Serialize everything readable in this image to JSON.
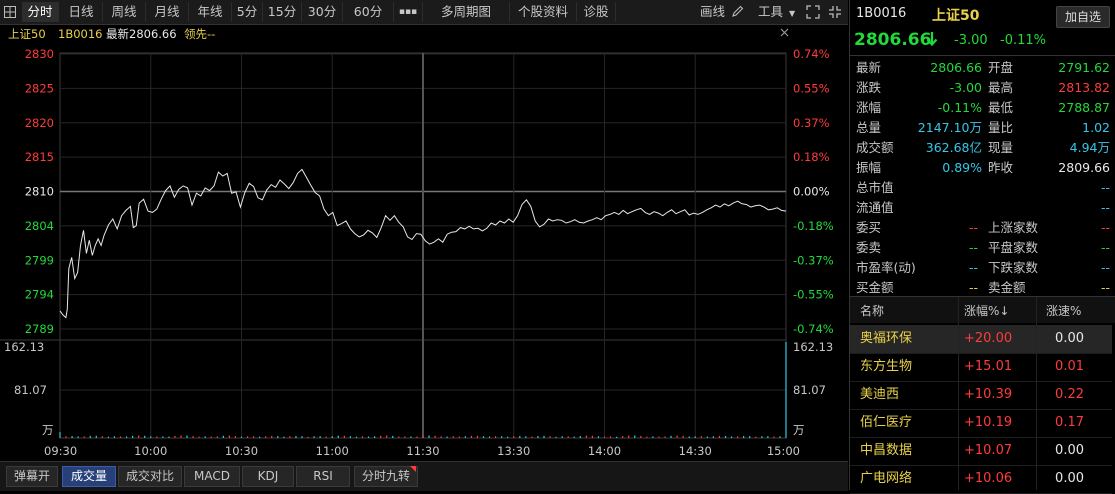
{
  "toolbar": {
    "tabs": [
      "分时",
      "日线",
      "周线",
      "月线",
      "年线",
      "5分",
      "15分",
      "30分",
      "60分",
      "▪▪▪",
      "多周期图",
      "个股资料",
      "诊股"
    ],
    "draw_label": "画线",
    "tools_label": "工具"
  },
  "chart_header": {
    "name": "上证50",
    "code": "1B0016",
    "latest": "最新2806.66",
    "lead": "领先--"
  },
  "chart_data": {
    "type": "line",
    "x_ticks": [
      "09:30",
      "10:00",
      "10:30",
      "11:00",
      "11:30",
      "13:30",
      "14:00",
      "14:30",
      "15:00"
    ],
    "y_left_ticks": [
      "2830",
      "2825",
      "2820",
      "2815",
      "2810",
      "2804",
      "2799",
      "2794",
      "2789"
    ],
    "y_right_ticks": [
      "0.74%",
      "0.55%",
      "0.37%",
      "0.18%",
      "0.00%",
      "-0.18%",
      "-0.37%",
      "-0.55%",
      "-0.74%"
    ],
    "prev_close": 2809.66,
    "ylim": [
      2788.87,
      2830.45
    ],
    "price": [
      [
        0,
        2791.6
      ],
      [
        2,
        2791.0
      ],
      [
        4,
        2790.6
      ],
      [
        5,
        2791.9
      ],
      [
        6,
        2798.0
      ],
      [
        8,
        2799.7
      ],
      [
        10,
        2796.5
      ],
      [
        12,
        2797.4
      ],
      [
        14,
        2801.5
      ],
      [
        16,
        2803.8
      ],
      [
        18,
        2800.3
      ],
      [
        20,
        2802.3
      ],
      [
        22,
        2800.0
      ],
      [
        24,
        2801.5
      ],
      [
        26,
        2802.5
      ],
      [
        28,
        2801.5
      ],
      [
        30,
        2803.0
      ],
      [
        33,
        2804.6
      ],
      [
        36,
        2805.5
      ],
      [
        39,
        2804.0
      ],
      [
        42,
        2806.0
      ],
      [
        45,
        2806.8
      ],
      [
        48,
        2807.4
      ],
      [
        50,
        2804.2
      ],
      [
        52,
        2804.5
      ],
      [
        54,
        2807.9
      ],
      [
        57,
        2808.5
      ],
      [
        60,
        2806.7
      ],
      [
        63,
        2806.5
      ],
      [
        66,
        2807.0
      ],
      [
        69,
        2808.5
      ],
      [
        72,
        2809.8
      ],
      [
        75,
        2810.5
      ],
      [
        78,
        2808.8
      ],
      [
        81,
        2810.0
      ],
      [
        84,
        2810.5
      ],
      [
        87,
        2810.2
      ],
      [
        90,
        2807.6
      ],
      [
        93,
        2809.4
      ],
      [
        96,
        2809.0
      ],
      [
        99,
        2810.2
      ],
      [
        102,
        2809.8
      ],
      [
        105,
        2810.5
      ],
      [
        108,
        2812.6
      ],
      [
        111,
        2812.0
      ],
      [
        114,
        2812.4
      ],
      [
        117,
        2809.4
      ],
      [
        120,
        2809.6
      ],
      [
        123,
        2807.3
      ],
      [
        126,
        2809.5
      ],
      [
        129,
        2810.9
      ],
      [
        132,
        2810.4
      ],
      [
        135,
        2808.7
      ],
      [
        138,
        2808.4
      ],
      [
        141,
        2809.9
      ],
      [
        144,
        2810.7
      ],
      [
        147,
        2810.3
      ],
      [
        150,
        2811.4
      ],
      [
        153,
        2810.8
      ],
      [
        156,
        2810.1
      ],
      [
        159,
        2811.0
      ],
      [
        162,
        2812.4
      ],
      [
        165,
        2813.0
      ],
      [
        168,
        2811.8
      ],
      [
        171,
        2810.6
      ],
      [
        174,
        2809.5
      ],
      [
        177,
        2809.0
      ],
      [
        180,
        2807.0
      ],
      [
        183,
        2806.0
      ],
      [
        186,
        2806.5
      ],
      [
        189,
        2804.5
      ],
      [
        192,
        2804.8
      ],
      [
        195,
        2805.2
      ],
      [
        198,
        2804.0
      ],
      [
        201,
        2803.3
      ],
      [
        204,
        2802.8
      ],
      [
        207,
        2803.1
      ],
      [
        210,
        2803.8
      ],
      [
        213,
        2803.4
      ],
      [
        216,
        2802.7
      ],
      [
        219,
        2804.2
      ],
      [
        222,
        2806.0
      ],
      [
        225,
        2805.3
      ],
      [
        228,
        2806.0
      ],
      [
        231,
        2805.0
      ],
      [
        234,
        2804.3
      ],
      [
        237,
        2802.8
      ],
      [
        240,
        2802.4
      ],
      [
        243,
        2803.3
      ],
      [
        246,
        2803.2
      ],
      [
        249,
        2802.2
      ],
      [
        252,
        2801.7
      ],
      [
        255,
        2802.0
      ],
      [
        258,
        2802.5
      ],
      [
        261,
        2802.0
      ],
      [
        264,
        2803.2
      ],
      [
        267,
        2803.5
      ],
      [
        270,
        2803.6
      ],
      [
        273,
        2804.2
      ],
      [
        276,
        2804.0
      ],
      [
        279,
        2804.4
      ],
      [
        282,
        2804.0
      ],
      [
        285,
        2804.1
      ],
      [
        288,
        2803.7
      ],
      [
        291,
        2804.1
      ],
      [
        294,
        2804.9
      ],
      [
        297,
        2804.6
      ],
      [
        300,
        2805.2
      ],
      [
        303,
        2804.9
      ],
      [
        306,
        2805.5
      ],
      [
        309,
        2805.0
      ],
      [
        312,
        2806.0
      ],
      [
        315,
        2807.7
      ],
      [
        318,
        2808.4
      ],
      [
        321,
        2807.4
      ],
      [
        324,
        2805.2
      ],
      [
        327,
        2804.3
      ],
      [
        330,
        2804.7
      ],
      [
        333,
        2805.5
      ],
      [
        336,
        2805.2
      ],
      [
        339,
        2805.4
      ],
      [
        342,
        2805.3
      ],
      [
        345,
        2804.9
      ],
      [
        348,
        2805.1
      ],
      [
        351,
        2805.4
      ],
      [
        354,
        2805.0
      ],
      [
        357,
        2804.9
      ],
      [
        360,
        2805.2
      ],
      [
        363,
        2805.4
      ],
      [
        366,
        2805.7
      ],
      [
        369,
        2805.4
      ],
      [
        372,
        2806.0
      ],
      [
        375,
        2806.2
      ],
      [
        378,
        2806.5
      ],
      [
        381,
        2806.2
      ],
      [
        384,
        2806.8
      ],
      [
        387,
        2806.3
      ],
      [
        390,
        2806.6
      ],
      [
        393,
        2806.9
      ],
      [
        396,
        2807.1
      ],
      [
        399,
        2806.5
      ],
      [
        402,
        2806.2
      ],
      [
        405,
        2806.6
      ],
      [
        408,
        2806.4
      ],
      [
        411,
        2806.0
      ],
      [
        414,
        2806.5
      ],
      [
        417,
        2806.9
      ],
      [
        420,
        2806.3
      ],
      [
        423,
        2806.6
      ],
      [
        426,
        2806.9
      ],
      [
        429,
        2806.1
      ],
      [
        432,
        2806.4
      ],
      [
        435,
        2806.2
      ],
      [
        438,
        2806.5
      ],
      [
        441,
        2806.9
      ],
      [
        444,
        2807.2
      ],
      [
        447,
        2807.6
      ],
      [
        450,
        2807.3
      ],
      [
        453,
        2807.8
      ],
      [
        456,
        2807.5
      ],
      [
        459,
        2807.9
      ],
      [
        462,
        2808.2
      ],
      [
        465,
        2807.8
      ],
      [
        468,
        2807.7
      ],
      [
        471,
        2807.3
      ],
      [
        474,
        2807.5
      ],
      [
        477,
        2807.6
      ],
      [
        480,
        2807.3
      ],
      [
        483,
        2806.9
      ],
      [
        486,
        2807.0
      ],
      [
        489,
        2807.2
      ],
      [
        492,
        2806.8
      ],
      [
        495,
        2806.7
      ]
    ],
    "volume": {
      "max_label": "162.13",
      "mid_label": "81.07",
      "unit_label": "万",
      "ylim": [
        0,
        162.13
      ],
      "first": 10.0,
      "last": 162.13,
      "typical": 3.5
    }
  },
  "bottom_bar": {
    "buttons": [
      "弹幕开",
      "成交量",
      "成交对比",
      "MACD",
      "KDJ",
      "RSI",
      "分时九转"
    ],
    "active": "成交量"
  },
  "quote": {
    "code": "1B0016",
    "name": "上证50",
    "add_fav": "加自选",
    "price": "2806.66",
    "change": "-3.00",
    "change_pct": "-0.11%",
    "rows": [
      {
        "l1": "最新",
        "v1": "2806.66",
        "c1": "green",
        "l2": "开盘",
        "v2": "2791.62",
        "c2": "green"
      },
      {
        "l1": "涨跌",
        "v1": "-3.00",
        "c1": "green",
        "l2": "最高",
        "v2": "2813.82",
        "c2": "red"
      },
      {
        "l1": "涨幅",
        "v1": "-0.11%",
        "c1": "green",
        "l2": "最低",
        "v2": "2788.87",
        "c2": "green"
      },
      {
        "l1": "总量",
        "v1": "2147.10万",
        "c1": "cyan",
        "l2": "量比",
        "v2": "1.02",
        "c2": "cyan"
      },
      {
        "l1": "成交额",
        "v1": "362.68亿",
        "c1": "cyan",
        "l2": "现量",
        "v2": "4.94万",
        "c2": "cyan"
      },
      {
        "l1": "振幅",
        "v1": "0.89%",
        "c1": "cyan",
        "l2": "昨收",
        "v2": "2809.66",
        "c2": "white"
      }
    ],
    "single_rows": [
      {
        "l": "总市值",
        "v": "--"
      },
      {
        "l": "流通值",
        "v": "--"
      }
    ],
    "pair_rows": [
      {
        "l1": "委买",
        "v1": "--",
        "c1": "red",
        "l2": "上涨家数",
        "v2": "--",
        "c2": "red"
      },
      {
        "l1": "委卖",
        "v1": "--",
        "c1": "green",
        "l2": "平盘家数",
        "v2": "--",
        "c2": "green"
      },
      {
        "l1": "市盈率(动)",
        "v1": "--",
        "c1": "cyan",
        "l2": "下跌家数",
        "v2": "--",
        "c2": "cyan"
      },
      {
        "l1": "买金额",
        "v1": "--",
        "c1": "yellow",
        "l2": "卖金额",
        "v2": "--",
        "c2": "yellow"
      }
    ]
  },
  "stocks": {
    "headers": [
      "名称",
      "涨幅%↓",
      "涨速%"
    ],
    "rows": [
      {
        "name": "奥福环保",
        "pct": "+20.00",
        "speed": "0.00"
      },
      {
        "name": "东方生物",
        "pct": "+15.01",
        "speed": "0.01"
      },
      {
        "name": "美迪西",
        "pct": "+10.39",
        "speed": "0.22"
      },
      {
        "name": "佰仁医疗",
        "pct": "+10.19",
        "speed": "0.17"
      },
      {
        "name": "中昌数据",
        "pct": "+10.07",
        "speed": "0.00"
      },
      {
        "name": "广电网络",
        "pct": "+10.06",
        "speed": "0.00"
      }
    ]
  }
}
